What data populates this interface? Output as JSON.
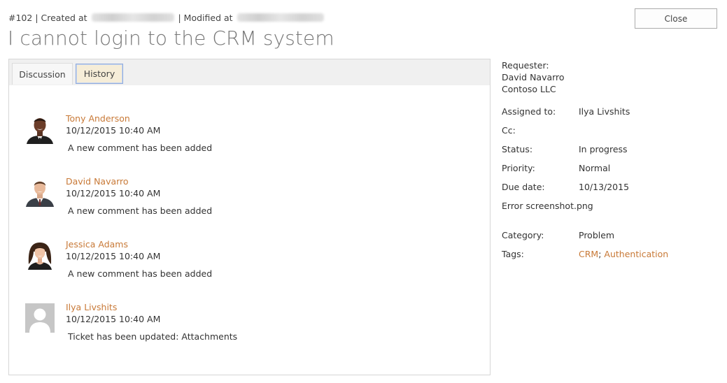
{
  "ticket": {
    "number": "#102",
    "created_label": "| Created at",
    "modified_label": "| Modified at",
    "title": "I cannot login to the CRM system"
  },
  "toolbar": {
    "close_label": "Close"
  },
  "tabs": [
    {
      "label": "Discussion",
      "active": false
    },
    {
      "label": "History",
      "active": true
    }
  ],
  "history": [
    {
      "author": "Tony Anderson",
      "time": "10/12/2015 10:40 AM",
      "message": "A new comment has been added",
      "avatar": "photo-man-dark"
    },
    {
      "author": "David Navarro",
      "time": "10/12/2015 10:40 AM",
      "message": "A new comment has been added",
      "avatar": "photo-man-light"
    },
    {
      "author": "Jessica Adams",
      "time": "10/12/2015 10:40 AM",
      "message": "A new comment has been added",
      "avatar": "photo-woman"
    },
    {
      "author": "Ilya Livshits",
      "time": "10/12/2015 10:40 AM",
      "message": "Ticket has been updated: Attachments",
      "avatar": "default-user-icon"
    }
  ],
  "details": {
    "requester_label": "Requester:",
    "requester_name": "David Navarro",
    "requester_company": "Contoso LLC",
    "assigned_label": "Assigned to:",
    "assigned_value": "Ilya Livshits",
    "cc_label": "Cc:",
    "cc_value": "",
    "status_label": "Status:",
    "status_value": "In progress",
    "priority_label": "Priority:",
    "priority_value": "Normal",
    "due_label": "Due date:",
    "due_value": "10/13/2015",
    "attachment": "Error screenshot.png",
    "category_label": "Category:",
    "category_value": "Problem",
    "tags_label": "Tags:",
    "tags": [
      "CRM",
      "Authentication"
    ],
    "tag_separator": ";"
  },
  "colors": {
    "link": "#c87937",
    "title": "#777777",
    "active_tab_bg": "#f6edd8",
    "active_tab_border": "#8faadc"
  }
}
